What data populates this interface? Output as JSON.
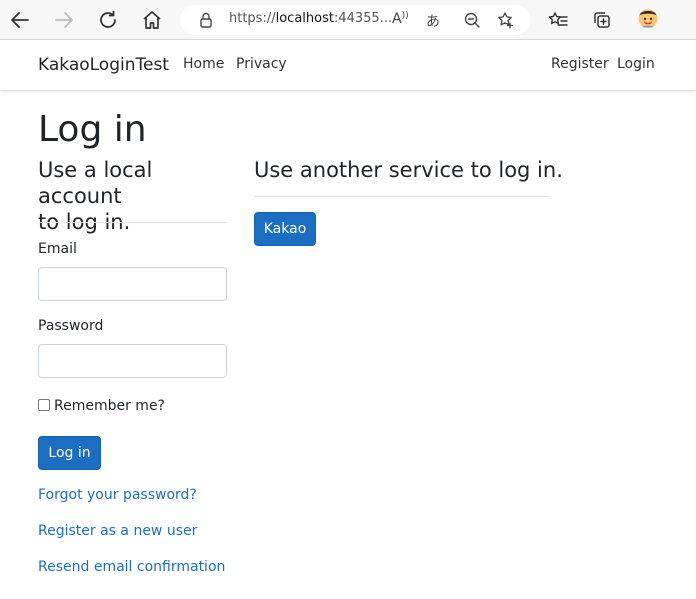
{
  "browser": {
    "url_scheme": "https://",
    "url_host": "localhost",
    "url_rest": ":44355...",
    "read_aloud_label": "A",
    "translate_label": "あ"
  },
  "navbar": {
    "brand": "KakaoLoginTest",
    "links": [
      "Home",
      "Privacy"
    ],
    "right_links": [
      "Register",
      "Login"
    ]
  },
  "page": {
    "title": "Log in",
    "local": {
      "heading_line1": "Use a local account",
      "heading_line2": "to log in.",
      "email_label": "Email",
      "password_label": "Password",
      "remember_label": "Remember me?",
      "login_button": "Log in",
      "forgot_link": "Forgot your password?",
      "register_link": "Register as a new user",
      "resend_link": "Resend email confirmation"
    },
    "external": {
      "heading": "Use another service to log in.",
      "kakao_button": "Kakao"
    }
  },
  "colors": {
    "primary": "#1b6ec2",
    "link": "#1b6ec2",
    "text": "#212529"
  }
}
